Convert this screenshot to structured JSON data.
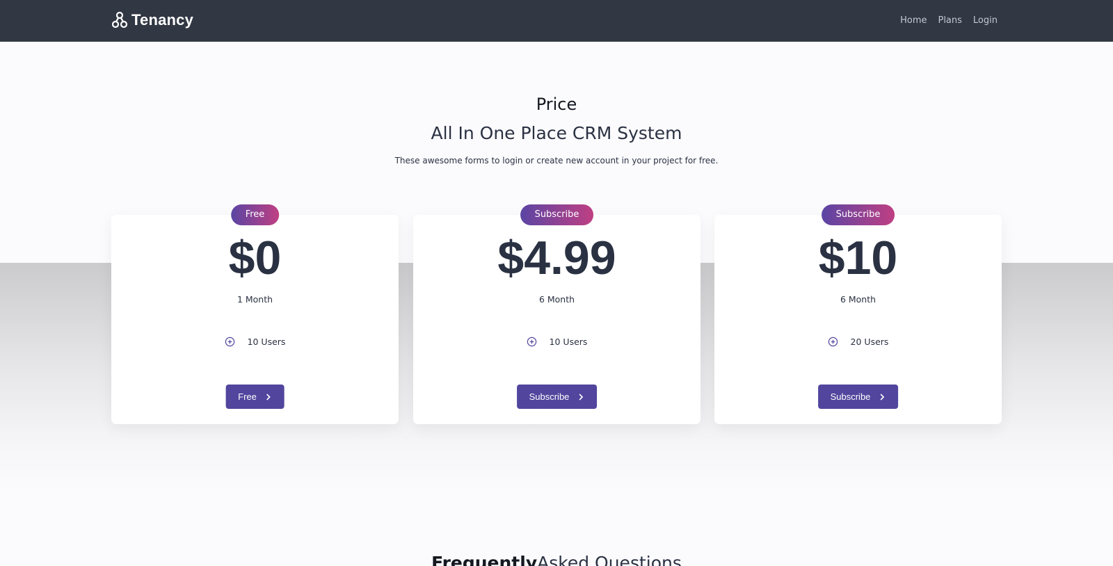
{
  "navbar": {
    "brand": "Tenancy",
    "links": [
      "Home",
      "Plans",
      "Login"
    ]
  },
  "hero": {
    "label": "Price",
    "title": "All In One Place CRM System",
    "subtitle": "These awesome forms to login or create new account in your project for free."
  },
  "plans": [
    {
      "badge": "Free",
      "price": "$0",
      "duration": "1 Month",
      "feature": "10 Users",
      "button": "Free"
    },
    {
      "badge": "Subscribe",
      "price": "$4.99",
      "duration": "6 Month",
      "feature": "10 Users",
      "button": "Subscribe"
    },
    {
      "badge": "Subscribe",
      "price": "$10",
      "duration": "6 Month",
      "feature": "20 Users",
      "button": "Subscribe"
    }
  ],
  "faq": {
    "title_bold": "Frequently",
    "title_rest": "Asked Questions"
  },
  "colors": {
    "navbar": "#313743",
    "primary": "#51459d",
    "badge_gradient_start": "#5b45a3",
    "badge_gradient_end": "#bf3f83",
    "text_dark": "#2a3142"
  },
  "icons": {
    "brand": "network-nodes-icon",
    "feature": "plus-circle-icon",
    "button": "chevron-right-icon"
  }
}
